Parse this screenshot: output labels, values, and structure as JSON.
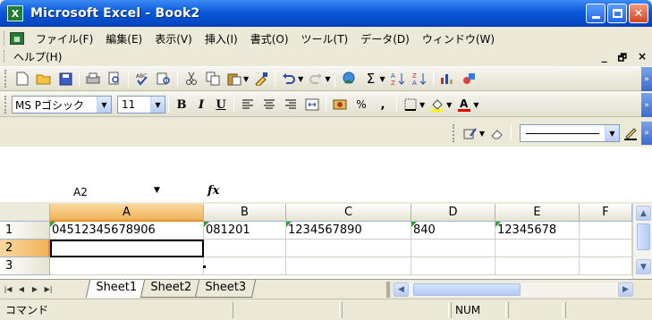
{
  "window": {
    "title": "Microsoft Excel - Book2",
    "app_icon_glyph": "X"
  },
  "menu": {
    "items": [
      "ファイル(F)",
      "編集(E)",
      "表示(V)",
      "挿入(I)",
      "書式(O)",
      "ツール(T)",
      "データ(D)",
      "ウィンドウ(W)"
    ],
    "help": "ヘルプ(H)",
    "mdi_minimize": "_",
    "mdi_restore": "🗗",
    "mdi_close": "×"
  },
  "format_toolbar": {
    "font_name": "MS Pゴシック",
    "font_size": "11",
    "bold": "B",
    "italic": "I",
    "underline": "U",
    "percent": "%",
    "comma": ","
  },
  "formula_bar": {
    "name_box": "A2",
    "fx_label": "fx",
    "formula": ""
  },
  "sheet": {
    "columns": [
      "A",
      "B",
      "C",
      "D",
      "E",
      "F"
    ],
    "active_column": "A",
    "rows": [
      {
        "header": "1",
        "cells": [
          "04512345678906",
          "081201",
          "1234567890",
          "840",
          "12345678",
          ""
        ]
      },
      {
        "header": "2",
        "cells": [
          "",
          "",
          "",
          "",
          "",
          ""
        ]
      },
      {
        "header": "3",
        "cells": [
          "",
          "",
          "",
          "",
          "",
          ""
        ]
      }
    ],
    "active_cell": "A2"
  },
  "tabs": {
    "sheets": [
      "Sheet1",
      "Sheet2",
      "Sheet3"
    ],
    "active": "Sheet1"
  },
  "status": {
    "mode": "コマンド",
    "num": "NUM"
  },
  "colors": {
    "titlebar": "#0a58d8",
    "active_header": "#f0b259",
    "error_triangle": "#3c9a3c"
  }
}
